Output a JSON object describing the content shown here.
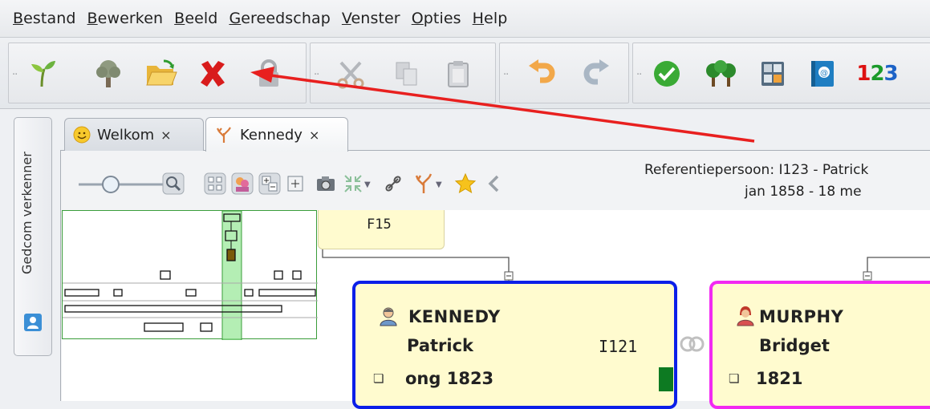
{
  "menubar": {
    "items": [
      {
        "label": "Bestand",
        "mnemonic": "B",
        "rest": "estand"
      },
      {
        "label": "Bewerken",
        "mnemonic": "B",
        "rest": "ewerken"
      },
      {
        "label": "Beeld",
        "mnemonic": "B",
        "rest": "eeld"
      },
      {
        "label": "Gereedschap",
        "mnemonic": "G",
        "rest": "ereedschap"
      },
      {
        "label": "Venster",
        "mnemonic": "V",
        "rest": "enster"
      },
      {
        "label": "Opties",
        "mnemonic": "O",
        "rest": "pties"
      },
      {
        "label": "Help",
        "mnemonic": "H",
        "rest": "elp"
      }
    ]
  },
  "toolbar": {
    "grip": "··",
    "icons": [
      "sprout-icon",
      "tree-icon",
      "open-folder-icon",
      "close-red-x-icon",
      "lock-icon",
      "cut-icon",
      "copy-icon",
      "paste-icon",
      "undo-icon",
      "redo-icon",
      "check-icon",
      "trees-icon",
      "calculator-icon",
      "address-book-icon",
      "counter-icon"
    ],
    "counter_label": "123"
  },
  "sidebar": {
    "label": "Gedcom verkenner"
  },
  "tabs": [
    {
      "label": "Welkom",
      "close": "×"
    },
    {
      "label": "Kennedy",
      "close": "×"
    }
  ],
  "view_toolbar": {
    "reference_line1": "Referentiepersoon: I123 - Patrick",
    "reference_line2": "jan 1858 - 18 me"
  },
  "tree": {
    "family_id": "F15",
    "persons": [
      {
        "surname": "KENNEDY",
        "given": "Patrick",
        "id": "I121",
        "birth": "ong 1823",
        "gender": "male"
      },
      {
        "surname": "MURPHY",
        "given": "Bridget",
        "id": "",
        "birth": "1821",
        "gender": "female"
      }
    ]
  },
  "colors": {
    "male_border": "#0b1fe8",
    "female_border": "#f229f2",
    "card_fill": "#fffbcf",
    "annotation_arrow": "#e8201f",
    "minimap_highlight": "#9be89b"
  }
}
